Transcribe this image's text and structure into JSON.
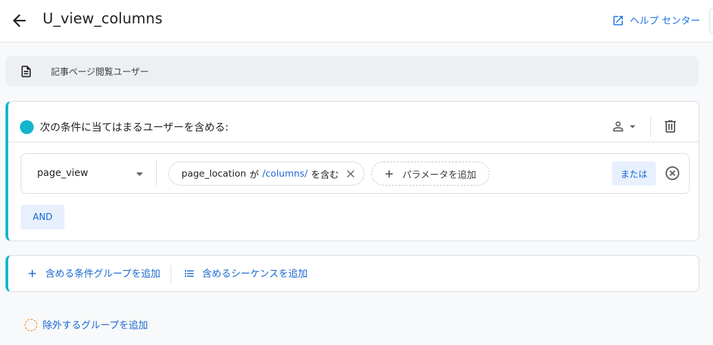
{
  "header": {
    "title": "U_view_columns",
    "help_label": "ヘルプ センター"
  },
  "segment": {
    "name": "記事ページ閲覧ユーザー"
  },
  "include_group": {
    "title": "次の条件に当てはまるユーザーを含める:",
    "accent_color": "#12b5cb",
    "condition": {
      "event": "page_view",
      "param_name": "page_location",
      "param_op_prefix": "が",
      "param_value": "/columns/",
      "param_op_suffix": "を含む",
      "add_param_label": "パラメータを追加",
      "or_label": "または"
    },
    "and_label": "AND"
  },
  "actions": {
    "add_condition_group": "含める条件グループを追加",
    "add_sequence": "含めるシーケンスを追加"
  },
  "exclude": {
    "add_label": "除外するグループを追加"
  }
}
